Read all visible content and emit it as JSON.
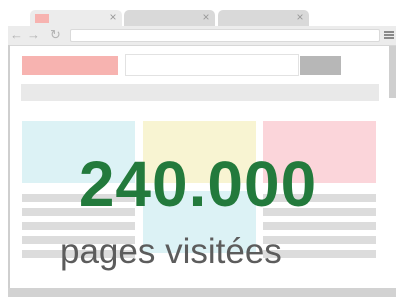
{
  "browser": {
    "tabs": [
      {
        "state": "active",
        "favicon_color": "#f7b3b0",
        "close_icon": "×"
      },
      {
        "state": "inactive",
        "close_icon": "×"
      },
      {
        "state": "inactive",
        "close_icon": "×"
      }
    ],
    "toolbar": {
      "back_icon": "←",
      "forward_icon": "→",
      "reload_icon": "↻"
    }
  },
  "page": {
    "cards": [
      {
        "color": "#dcf2f5"
      },
      {
        "color": "#f8f4d2"
      },
      {
        "color": "#fbd5da"
      }
    ]
  },
  "headline": {
    "value": "240.000",
    "caption": "pages visitées",
    "color": "#237a3c"
  }
}
